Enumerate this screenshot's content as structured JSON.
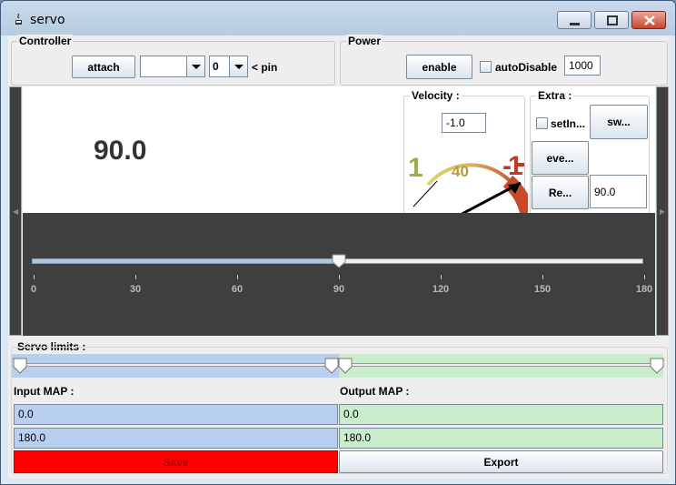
{
  "window": {
    "title": "servo"
  },
  "controller": {
    "title": "Controller",
    "attach_label": "attach",
    "port_value": "",
    "pin_value": "0",
    "pin_suffix": "< pin"
  },
  "power": {
    "title": "Power",
    "enable_label": "enable",
    "auto_disable_label": "autoDisable",
    "auto_disable_value": "1000"
  },
  "main": {
    "position": "90.0",
    "velocity": {
      "title": "Velocity :",
      "value": "-1.0"
    },
    "gauge": {
      "left_label": "1",
      "mid_label": "40",
      "right_label": "-1"
    },
    "extra": {
      "title": "Extra :",
      "set_inverted_label": "setIn...",
      "sweep_label": "sw...",
      "events_label": "eve...",
      "rest_label": "Re...",
      "rest_value": "90.0"
    },
    "slider": {
      "value": 90,
      "min": 0,
      "max": 180,
      "ticks": [
        "0",
        "30",
        "60",
        "90",
        "120",
        "150",
        "180"
      ]
    }
  },
  "limits": {
    "title": "Servo limits :",
    "input_map_label": "Input MAP :",
    "output_map_label": "Output MAP :",
    "input_min": "0.0",
    "input_max": "180.0",
    "output_min": "0.0",
    "output_max": "180.0",
    "save_label": "Save",
    "export_label": "Export"
  },
  "colors": {
    "save": "#ff0000",
    "input_strip": "#b8cff0",
    "output_strip": "#c8eccc",
    "dark_panel": "#3f3f3f"
  }
}
